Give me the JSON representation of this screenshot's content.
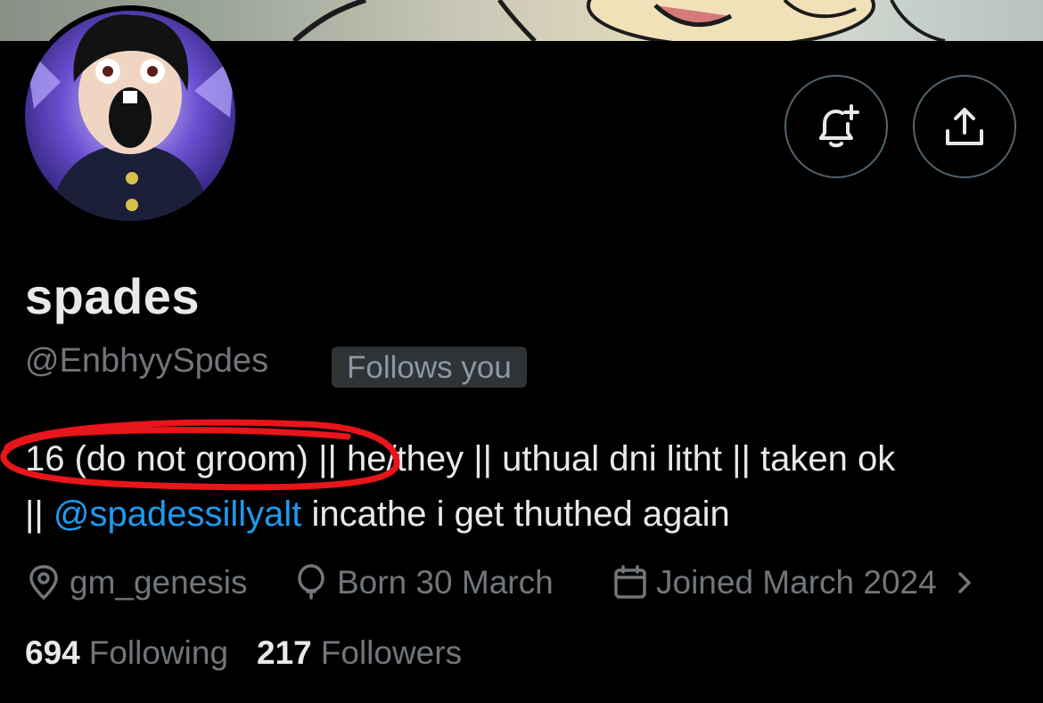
{
  "profile": {
    "display_name": "spades",
    "handle": "@EnbhyySpdes",
    "follows_you_badge": "Follows you",
    "bio": {
      "line1": "16 (do not groom) || he/they || uthual dni litht || taken ok",
      "line2_prefix": "|| ",
      "mention": "@spadessillyalt",
      "line2_suffix": " incathe i get thuthed again"
    },
    "location": "gm_genesis",
    "birthday": "Born 30 March",
    "joined": "Joined March 2024"
  },
  "stats": {
    "following_count": "694",
    "following_label": "Following",
    "followers_count": "217",
    "followers_label": "Followers"
  },
  "icons": {
    "notify": "bell-plus-icon",
    "share": "share-icon",
    "location": "location-pin-icon",
    "birthday": "balloon-icon",
    "joined": "calendar-icon",
    "more": "chevron-right-icon"
  },
  "colors": {
    "background": "#000000",
    "text": "#e7e9ea",
    "secondary_text": "#71767b",
    "link": "#1d9bf0",
    "annotation": "#e8151b"
  }
}
